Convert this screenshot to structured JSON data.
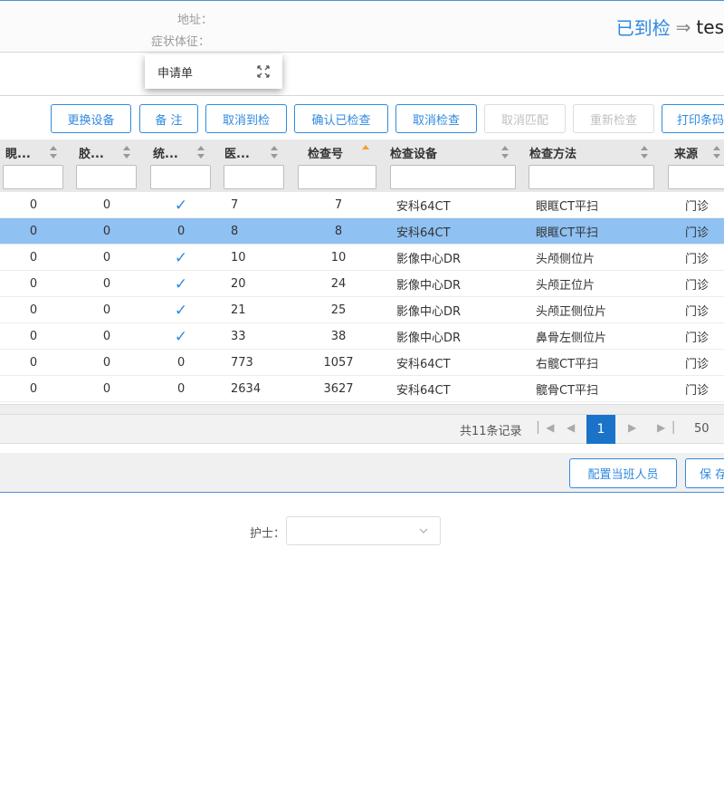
{
  "patient_info": {
    "address_label": "地址：",
    "symptom_label": "症状体征："
  },
  "status": {
    "text": "已到检",
    "user": "tes",
    "accent_color": "#2f8ae0"
  },
  "tab": {
    "label": "申请单",
    "icon": "expand-icon"
  },
  "toolbar": {
    "buttons": [
      {
        "label": "更换设备",
        "disabled": false
      },
      {
        "label": "备 注",
        "disabled": false
      },
      {
        "label": "取消到检",
        "disabled": false
      },
      {
        "label": "确认已检查",
        "disabled": false
      },
      {
        "label": "取消检查",
        "disabled": false
      },
      {
        "label": "取消匹配",
        "disabled": true
      },
      {
        "label": "重新检查",
        "disabled": true
      },
      {
        "label": "打印条码",
        "disabled": false
      }
    ]
  },
  "table": {
    "columns": [
      "睍...",
      "胶...",
      "统...",
      "医...",
      "检查号",
      "检查设备",
      "检查方法",
      "来源"
    ],
    "sorted_column": "检查号",
    "sort_direction": "asc",
    "rows": [
      {
        "c1": "0",
        "c2": "0",
        "stat": "check",
        "c4": "7",
        "exam_no": "7",
        "device": "安科64CT",
        "method": "眼眶CT平扫",
        "source": "门诊",
        "selected": false
      },
      {
        "c1": "0",
        "c2": "0",
        "stat": "0",
        "c4": "8",
        "exam_no": "8",
        "device": "安科64CT",
        "method": "眼眶CT平扫",
        "source": "门诊",
        "selected": true
      },
      {
        "c1": "0",
        "c2": "0",
        "stat": "check",
        "c4": "10",
        "exam_no": "10",
        "device": "影像中心DR",
        "method": "头颅侧位片",
        "source": "门诊",
        "selected": false
      },
      {
        "c1": "0",
        "c2": "0",
        "stat": "check",
        "c4": "20",
        "exam_no": "24",
        "device": "影像中心DR",
        "method": "头颅正位片",
        "source": "门诊",
        "selected": false
      },
      {
        "c1": "0",
        "c2": "0",
        "stat": "check",
        "c4": "21",
        "exam_no": "25",
        "device": "影像中心DR",
        "method": "头颅正侧位片",
        "source": "门诊",
        "selected": false
      },
      {
        "c1": "0",
        "c2": "0",
        "stat": "check",
        "c4": "33",
        "exam_no": "38",
        "device": "影像中心DR",
        "method": "鼻骨左侧位片",
        "source": "门诊",
        "selected": false
      },
      {
        "c1": "0",
        "c2": "0",
        "stat": "0",
        "c4": "773",
        "exam_no": "1057",
        "device": "安科64CT",
        "method": "右髋CT平扫",
        "source": "门诊",
        "selected": false
      },
      {
        "c1": "0",
        "c2": "0",
        "stat": "0",
        "c4": "2634",
        "exam_no": "3627",
        "device": "安科64CT",
        "method": "髋骨CT平扫",
        "source": "门诊",
        "selected": false
      }
    ]
  },
  "pager": {
    "total_text": "共11条记录",
    "current_page": "1",
    "page_size": "50"
  },
  "footer": {
    "assign_button": "配置当班人员",
    "save_button": "保 存"
  },
  "nurse": {
    "label": "护士：",
    "value": ""
  }
}
